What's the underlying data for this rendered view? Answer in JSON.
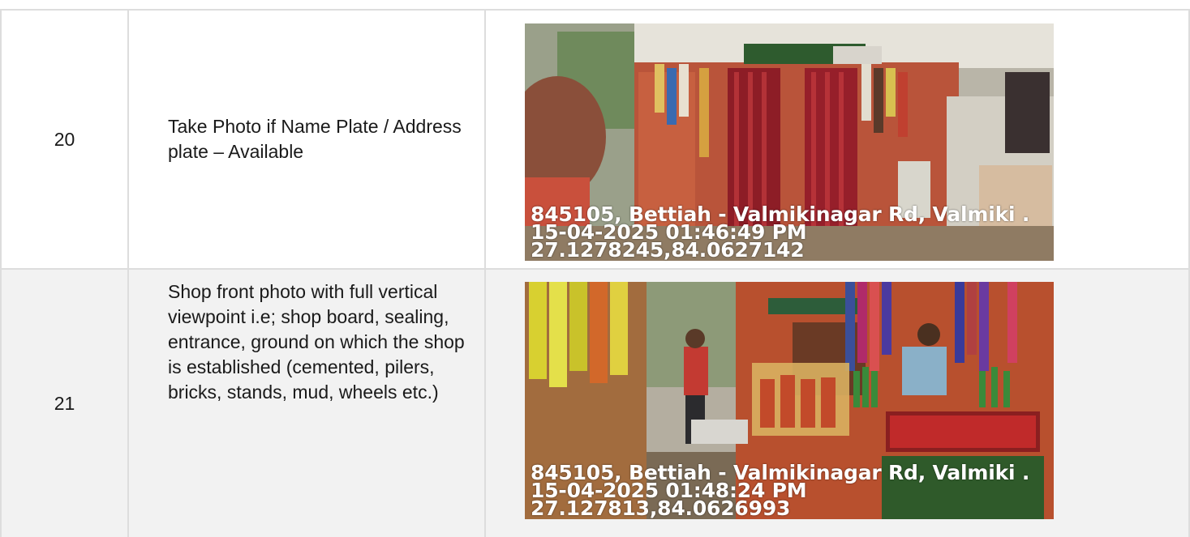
{
  "rows": [
    {
      "number": "20",
      "description": "Take Photo if Name Plate / Address plate – Available",
      "photo": {
        "subject": "roadside shop interior with red curtains",
        "overlay_address": "845105, Bettiah - Valmikinagar Rd, Valmiki .",
        "overlay_datetime": "15-04-2025 01:46:49 PM",
        "overlay_coords": "27.1278245,84.0627142"
      }
    },
    {
      "number": "21",
      "description": "Shop front photo with full vertical viewpoint i.e; shop board, sealing, entrance, ground on which the shop is established (cemented, pilers, bricks, stands, mud, wheels etc.)",
      "photo": {
        "subject": "shop front with hanging snack packets and counter",
        "overlay_address": "845105, Bettiah - Valmikinagar Rd, Valmiki .",
        "overlay_datetime": "15-04-2025 01:48:24 PM",
        "overlay_coords": "27.127813,84.0626993"
      }
    }
  ],
  "colors": {
    "border": "#dddddd",
    "alt_row_bg": "#f2f2f2",
    "text": "#1a1a1a"
  }
}
